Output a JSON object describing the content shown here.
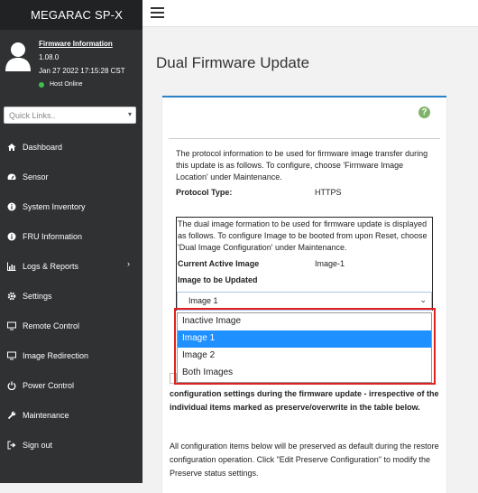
{
  "brand": "MEGARAC SP-X",
  "user": {
    "firmware_link": "Firmware Information",
    "version": "1.08.0",
    "datetime": "Jan 27 2022 17:15:28 CST",
    "host_status": "Host Online",
    "status_color": "#3fbf4f"
  },
  "quick_links": {
    "placeholder": "Quick Links.."
  },
  "nav": [
    {
      "label": "Dashboard",
      "icon": "home-icon"
    },
    {
      "label": "Sensor",
      "icon": "speedometer-icon"
    },
    {
      "label": "System Inventory",
      "icon": "info-icon"
    },
    {
      "label": "FRU Information",
      "icon": "info-icon"
    },
    {
      "label": "Logs & Reports",
      "icon": "bar-chart-icon",
      "chevron": "›"
    },
    {
      "label": "Settings",
      "icon": "gear-icon"
    },
    {
      "label": "Remote Control",
      "icon": "monitor-icon"
    },
    {
      "label": "Image Redirection",
      "icon": "monitor-icon"
    },
    {
      "label": "Power Control",
      "icon": "power-icon"
    },
    {
      "label": "Maintenance",
      "icon": "wrench-icon"
    },
    {
      "label": "Sign out",
      "icon": "sign-out-icon"
    }
  ],
  "page": {
    "title": "Dual Firmware Update",
    "help_symbol": "?"
  },
  "protocol": {
    "text": "The protocol information to be used for firmware image transfer during this update is as follows. To configure, choose 'Firmware Image Location' under Maintenance.",
    "type_label": "Protocol Type:",
    "type_value": "HTTPS"
  },
  "image": {
    "text": "The dual image formation to be used for firmware update is displayed as follows. To configure Image to be booted from upon Reset, choose 'Dual Image Configuration' under Maintenance.",
    "current_label": "Current Active Image",
    "current_value": "Image-1",
    "update_label": "Image to be Updated",
    "selected": "Image 1",
    "options": [
      "Inactive Image",
      "Image 1",
      "Image 2",
      "Both Images"
    ]
  },
  "config": {
    "bold_text": "configuration settings during the firmware update - irrespective of the individual items marked as preserve/overwrite in the table below.",
    "text": "All configuration items below will be preserved as default during the restore configuration operation. Click \"Edit Preserve Configuration\" to modify the Preserve status settings."
  },
  "colors": {
    "sidebar": "#2f3133",
    "accent": "#2a83c9",
    "selected_option": "#1e90ff",
    "highlight_outline": "#e02020"
  }
}
